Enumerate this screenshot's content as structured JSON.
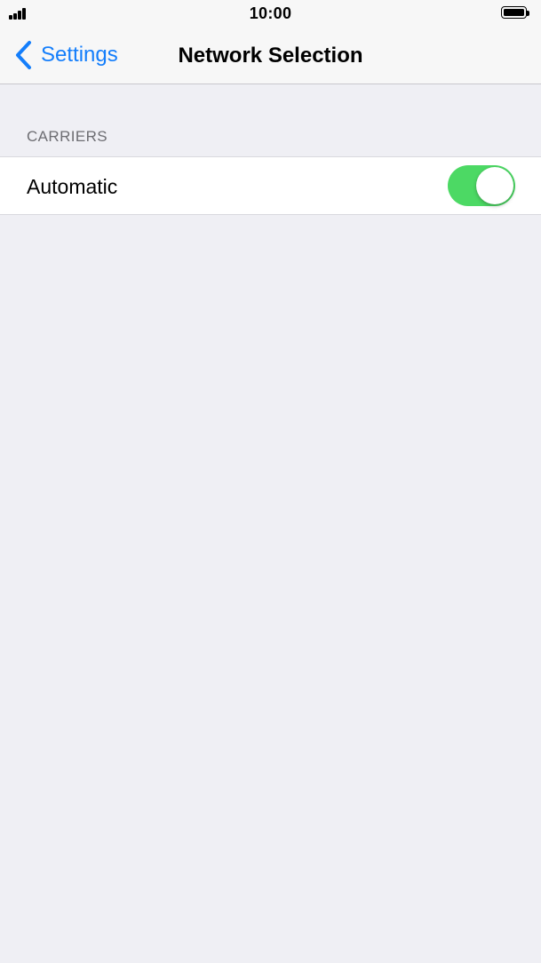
{
  "status_bar": {
    "time": "10:00",
    "signal_icon": "signal-bars-icon",
    "battery_icon": "battery-full-icon"
  },
  "nav": {
    "back_label": "Settings",
    "back_icon": "chevron-left-icon",
    "title": "Network Selection"
  },
  "carriers": {
    "header": "CARRIERS",
    "rows": [
      {
        "label": "Automatic",
        "toggle_on": true
      }
    ]
  },
  "colors": {
    "accent": "#147efb",
    "toggle_on": "#4cd964",
    "background": "#efeff4"
  }
}
